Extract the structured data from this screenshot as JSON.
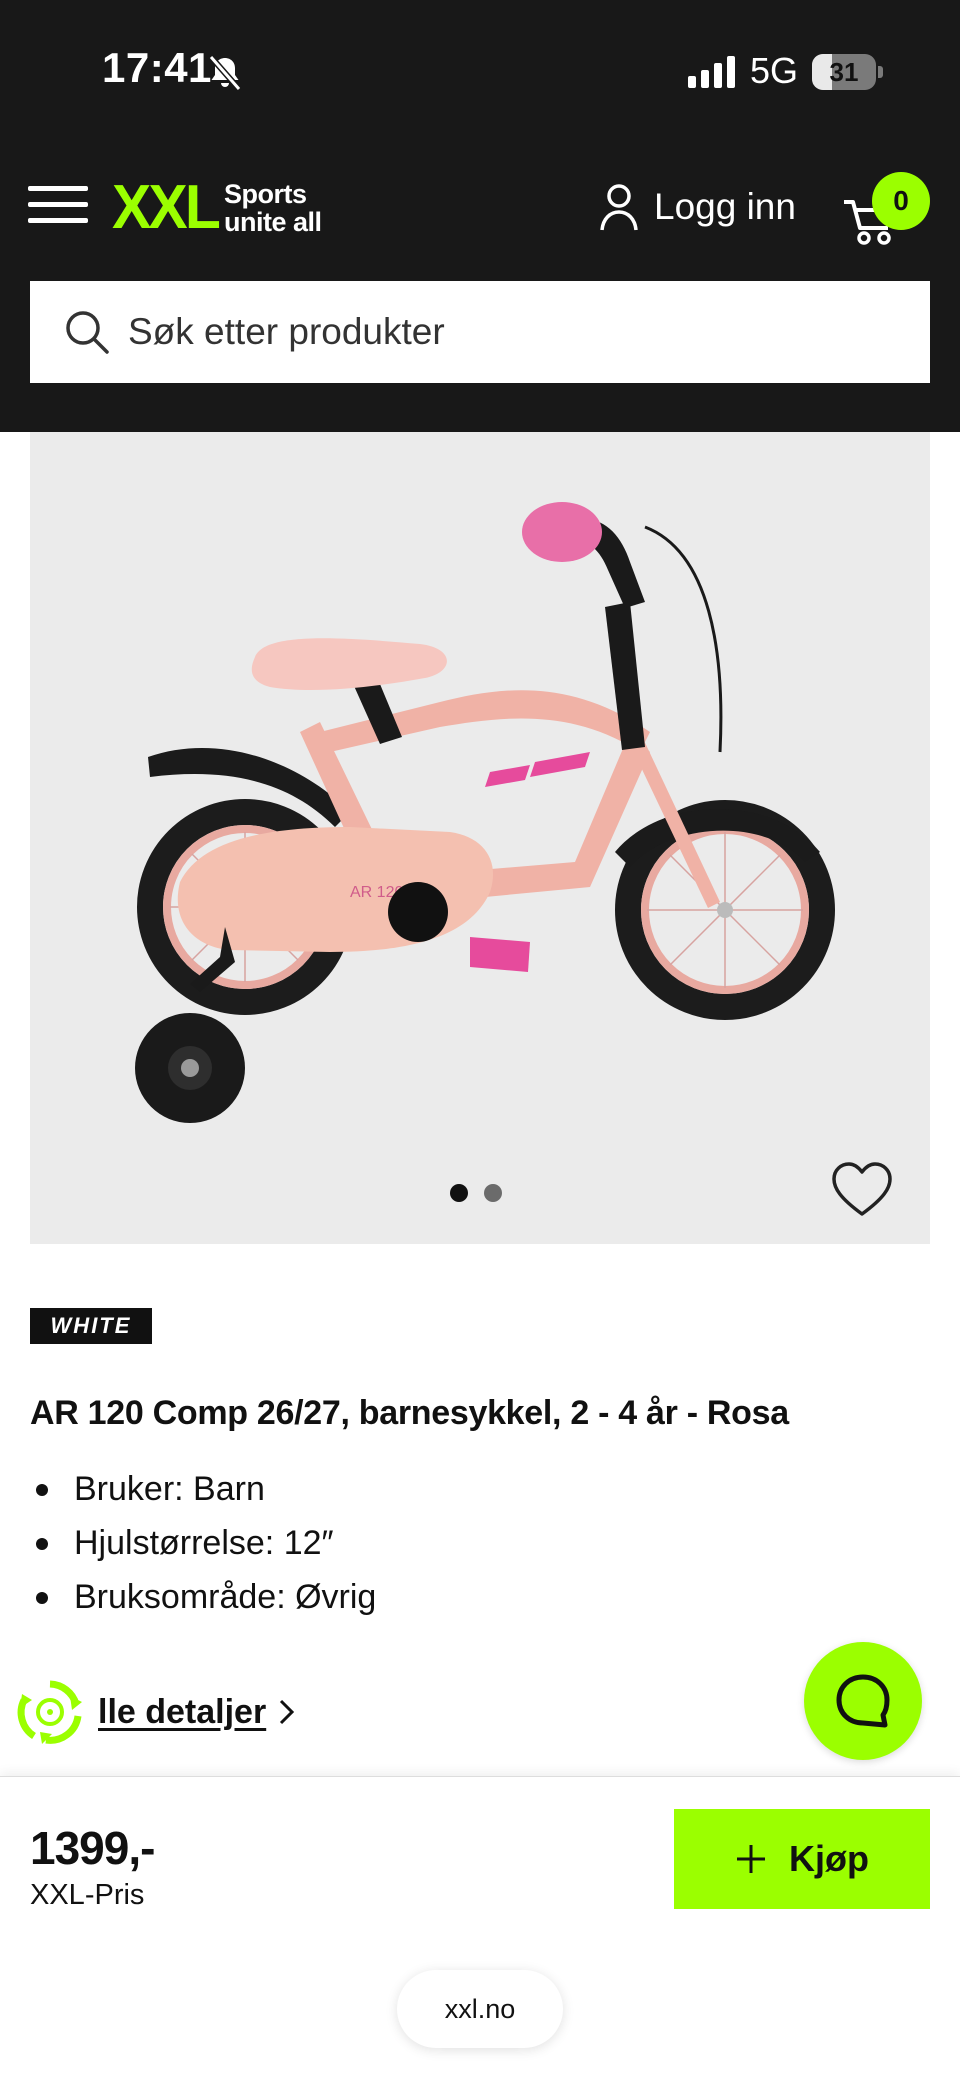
{
  "status_bar": {
    "time": "17:41",
    "network": "5G",
    "battery_percent": "31",
    "battery_level": 0.31
  },
  "header": {
    "logo_mark": "XXL",
    "logo_tagline_1": "Sports",
    "logo_tagline_2": "unite all",
    "login_label": "Logg inn",
    "cart_count": "0",
    "accent_color": "#9bff00",
    "background_color": "#181818"
  },
  "search": {
    "placeholder": "Søk etter produkter"
  },
  "gallery": {
    "image_count": 2,
    "active_index": 0
  },
  "product": {
    "brand": "WHITE",
    "title": "AR 120 Comp 26/27, barnesykkel, 2 - 4 år - Rosa",
    "features": [
      "Bruker: Barn",
      "Hjulstørrelse: 12″",
      "Bruksområde: Øvrig"
    ],
    "details_link": "lle detaljer"
  },
  "purchase": {
    "price": "1399,-",
    "price_label": "XXL-Pris",
    "buy_label": "Kjøp"
  },
  "browser": {
    "url": "xxl.no"
  }
}
